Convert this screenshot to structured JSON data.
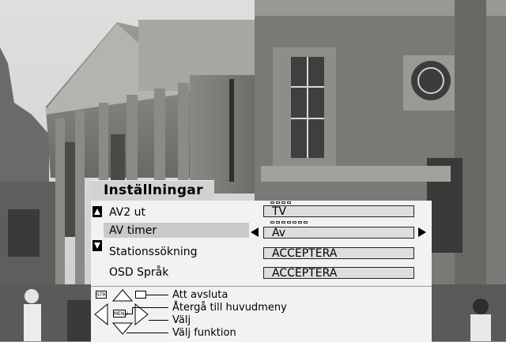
{
  "menu": {
    "title": "Inställningar",
    "rows": [
      {
        "label": "AV2 ut",
        "value": "TV",
        "dots": 4
      },
      {
        "label": "AV timer",
        "value": "Av",
        "dots": 7,
        "selected": true
      },
      {
        "label": "Stationssökning",
        "value": "ACCEPTERA"
      },
      {
        "label": "OSD Språk",
        "value": "ACCEPTERA"
      }
    ]
  },
  "help": {
    "exit_label": "Att avsluta",
    "back_label": "Återgå till huvudmeny",
    "select_label": "Välj",
    "function_label": "Välj funktion",
    "key_str": "STR",
    "key_menu": "MENU"
  },
  "icons": {
    "scroll_up": "triangle-up-icon",
    "scroll_down": "triangle-down-icon",
    "value_left": "triangle-left-icon",
    "value_right": "triangle-right-icon"
  },
  "colors": {
    "panel": "#f2f2f2",
    "highlight": "#c9c9c9",
    "value_box": "#dedede"
  }
}
